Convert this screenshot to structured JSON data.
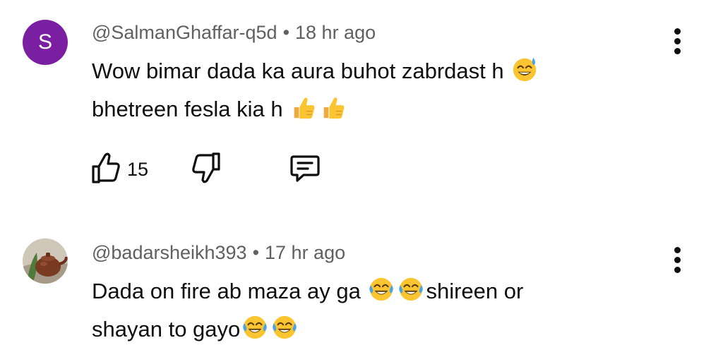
{
  "comments": [
    {
      "author": "@SalmanGhaffar-q5d",
      "separator": "•",
      "time": "18 hr ago",
      "avatar_letter": "S",
      "avatar_color": "#7b1fa2",
      "line1": "Wow bimar dada ka aura buhot zabrdast h",
      "line2": "bhetreen fesla kia h",
      "like_count": "15"
    },
    {
      "author": "@badarsheikh393",
      "separator": "•",
      "time": "17 hr ago",
      "line1_a": "Dada on fire ab maza ay ga",
      "line1_b": "shireen or",
      "line2": "shayan to gayo"
    }
  ],
  "icons": {
    "like": "thumb-up-outline",
    "dislike": "thumb-down-outline",
    "reply": "comment-bubble",
    "more": "vertical-ellipsis",
    "emoji_sweat_smile": "grinning-face-with-sweat",
    "emoji_thumbs_up": "thumbs-up",
    "emoji_tears_of_joy": "face-with-tears-of-joy"
  }
}
